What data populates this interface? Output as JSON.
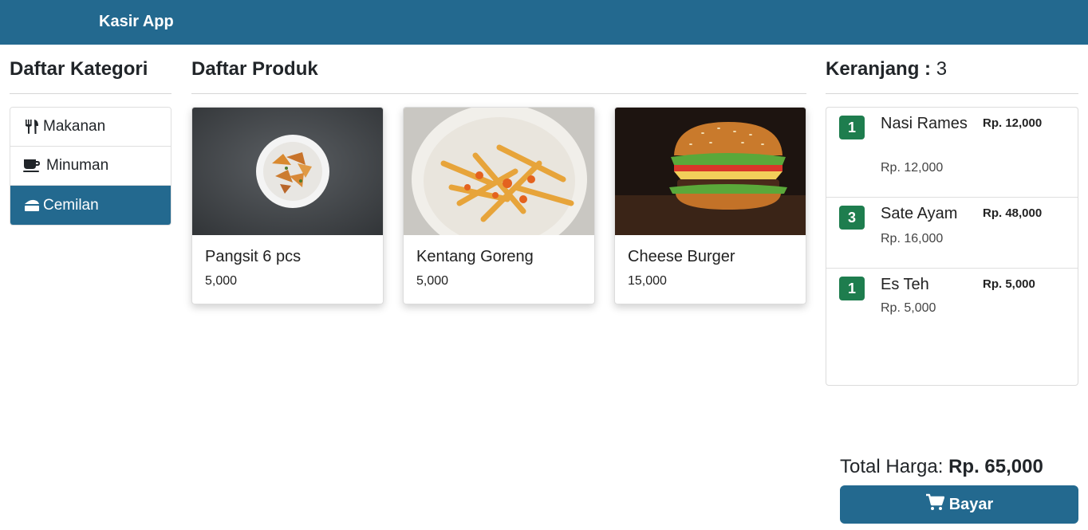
{
  "navbar": {
    "brand": "Kasir App"
  },
  "categories": {
    "title": "Daftar Kategori",
    "items": [
      {
        "label": "Makanan",
        "icon": "utensils-icon",
        "active": false
      },
      {
        "label": "Minuman",
        "icon": "coffee-icon",
        "active": false
      },
      {
        "label": "Cemilan",
        "icon": "cheese-icon",
        "active": true
      }
    ]
  },
  "products": {
    "title": "Daftar Produk",
    "items": [
      {
        "name": "Pangsit 6 pcs",
        "price": "5,000",
        "image": "pangsit-photo"
      },
      {
        "name": "Kentang Goreng",
        "price": "5,000",
        "image": "fries-photo"
      },
      {
        "name": "Cheese Burger",
        "price": "15,000",
        "image": "burger-photo"
      }
    ]
  },
  "cart": {
    "title": "Keranjang :",
    "count": "3",
    "items": [
      {
        "qty": "1",
        "name": "Nasi Rames",
        "unit_price": "Rp. 12,000",
        "subtotal": "Rp. 12,000"
      },
      {
        "qty": "3",
        "name": "Sate Ayam",
        "unit_price": "Rp. 16,000",
        "subtotal": "Rp. 48,000"
      },
      {
        "qty": "1",
        "name": "Es Teh",
        "unit_price": "Rp. 5,000",
        "subtotal": "Rp. 5,000"
      }
    ],
    "total_label": "Total Harga:",
    "total_value": "Rp. 65,000",
    "pay_label": "Bayar"
  },
  "colors": {
    "primary": "#23698f",
    "badge": "#1e7d4e"
  }
}
